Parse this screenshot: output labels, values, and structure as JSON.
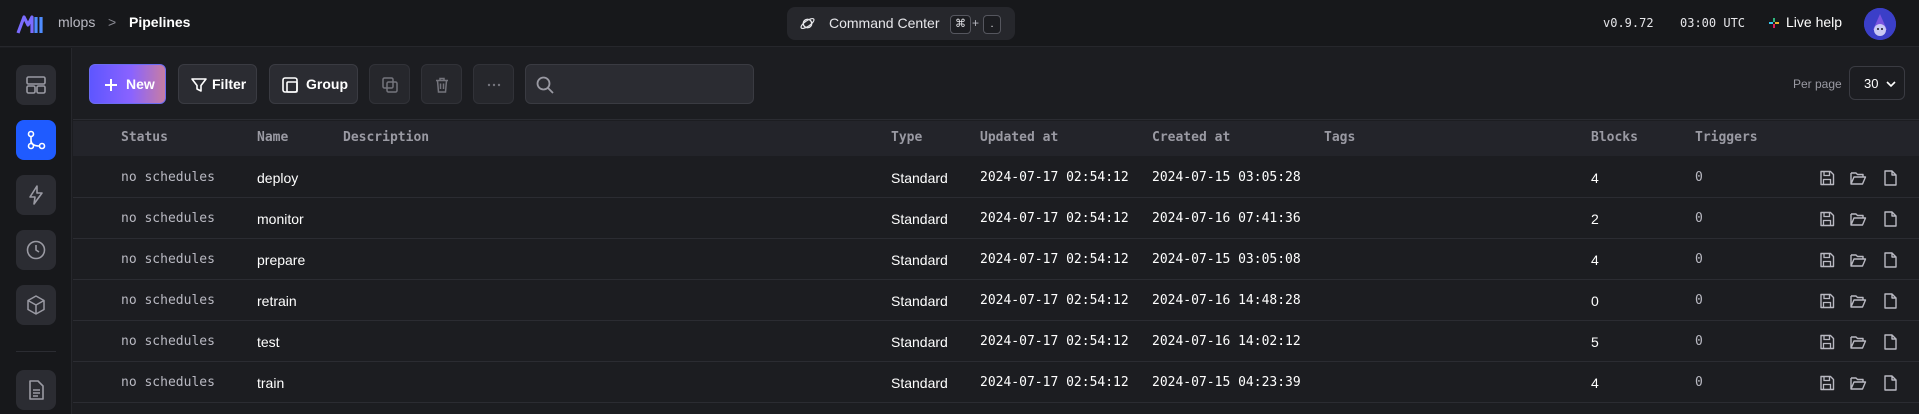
{
  "header": {
    "breadcrumb_root": "mlops",
    "breadcrumb_sep": ">",
    "page_title": "Pipelines",
    "command_center": {
      "label": "Command Center",
      "key1": "⌘",
      "plus": "+",
      "key2": "."
    },
    "version": "v0.9.72",
    "time": "03:00 UTC",
    "live_help": "Live help",
    "colors": {
      "bar": "#17181b",
      "command_bg": "#26272c"
    }
  },
  "sidebar": {
    "items": [
      {
        "icon": "layout-icon",
        "active": false
      },
      {
        "icon": "pipelines-icon",
        "active": true
      },
      {
        "icon": "lightning-icon",
        "active": false
      },
      {
        "icon": "clock-icon",
        "active": false
      },
      {
        "icon": "cube-icon",
        "active": false
      },
      {
        "icon": "document-icon",
        "active": false
      }
    ],
    "accent": "#1f5bff"
  },
  "toolbar": {
    "new_label": "New",
    "filter_label": "Filter",
    "group_label": "Group",
    "search_placeholder": "",
    "per_page_label": "Per page",
    "per_page_value": "30",
    "new_gradient": [
      "#5e56ff",
      "#8a63ff",
      "#c77da3"
    ]
  },
  "table": {
    "columns": [
      "Status",
      "Name",
      "Description",
      "Type",
      "Updated at",
      "Created at",
      "Tags",
      "Blocks",
      "Triggers"
    ],
    "rows": [
      {
        "status": "no schedules",
        "name": "deploy",
        "description": "",
        "type": "Standard",
        "updated": "2024-07-17 02:54:12",
        "created": "2024-07-15 03:05:28",
        "tags": "",
        "blocks": "4",
        "triggers": "0"
      },
      {
        "status": "no schedules",
        "name": "monitor",
        "description": "",
        "type": "Standard",
        "updated": "2024-07-17 02:54:12",
        "created": "2024-07-16 07:41:36",
        "tags": "",
        "blocks": "2",
        "triggers": "0"
      },
      {
        "status": "no schedules",
        "name": "prepare",
        "description": "",
        "type": "Standard",
        "updated": "2024-07-17 02:54:12",
        "created": "2024-07-15 03:05:08",
        "tags": "",
        "blocks": "4",
        "triggers": "0"
      },
      {
        "status": "no schedules",
        "name": "retrain",
        "description": "",
        "type": "Standard",
        "updated": "2024-07-17 02:54:12",
        "created": "2024-07-16 14:48:28",
        "tags": "",
        "blocks": "0",
        "triggers": "0"
      },
      {
        "status": "no schedules",
        "name": "test",
        "description": "",
        "type": "Standard",
        "updated": "2024-07-17 02:54:12",
        "created": "2024-07-16 14:02:12",
        "tags": "",
        "blocks": "5",
        "triggers": "0"
      },
      {
        "status": "no schedules",
        "name": "train",
        "description": "",
        "type": "Standard",
        "updated": "2024-07-17 02:54:12",
        "created": "2024-07-15 04:23:39",
        "tags": "",
        "blocks": "4",
        "triggers": "0"
      }
    ],
    "row_actions": [
      "save-icon",
      "folder-open-icon",
      "file-icon"
    ]
  }
}
